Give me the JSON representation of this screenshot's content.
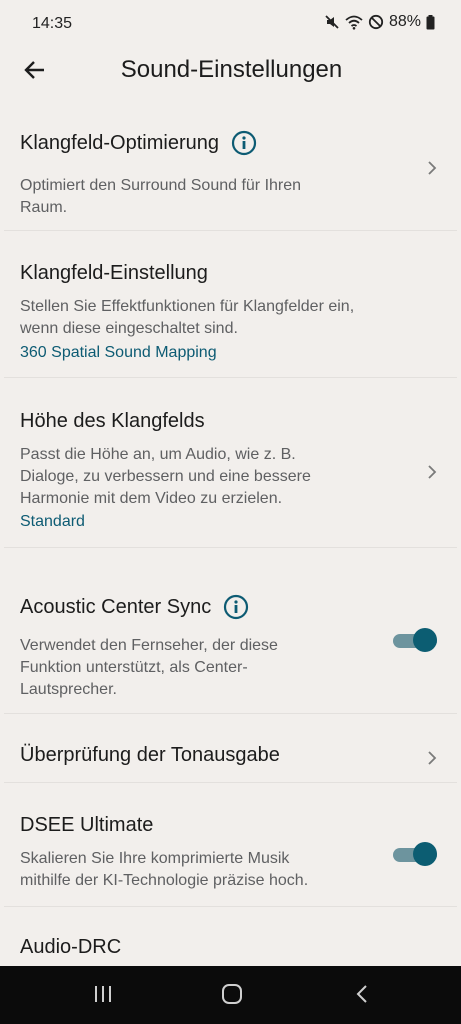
{
  "status_bar": {
    "time": "14:35",
    "battery": "88%",
    "icons": [
      "mute-icon",
      "wifi-icon",
      "do-not-disturb-icon",
      "battery-icon"
    ]
  },
  "header": {
    "title": "Sound-Einstellungen",
    "back_icon": "arrow-left-icon"
  },
  "settings": {
    "klangfeld_optimierung": {
      "title": "Klangfeld-Optimierung",
      "description_line1": "Optimiert den Surround Sound für Ihren",
      "description_line2": "Raum."
    },
    "klangfeld_einstellung": {
      "title": "Klangfeld-Einstellung",
      "description_line1": "Stellen Sie Effektfunktionen für Klangfelder ein,",
      "description_line2": "wenn diese eingeschaltet sind.",
      "value": "360 Spatial Sound Mapping"
    },
    "hoehe_klangfeld": {
      "title": "Höhe des Klangfelds",
      "description_line1": "Passt die Höhe an, um Audio, wie z. B.",
      "description_line2": "Dialoge, zu verbessern und eine bessere",
      "description_line3": "Harmonie mit dem Video zu erzielen.",
      "value": "Standard"
    },
    "acoustic_center_sync": {
      "title": "Acoustic Center Sync",
      "description_line1": "Verwendet den Fernseher, der diese",
      "description_line2": "Funktion unterstützt, als Center-",
      "description_line3": "Lautsprecher.",
      "enabled": true
    },
    "tonausgabe": {
      "title": "Überprüfung der Tonausgabe"
    },
    "dsee_ultimate": {
      "title": "DSEE Ultimate",
      "description_line1": "Skalieren Sie Ihre komprimierte Musik",
      "description_line2": "mithilfe der KI-Technologie präzise hoch.",
      "enabled": true
    },
    "audio_drc": {
      "title": "Audio-DRC"
    }
  },
  "colors": {
    "background": "#f2efec",
    "accent": "#0d5b73",
    "toggle_thumb": "#0c5d72",
    "toggle_track": "#6d949e",
    "description": "#5f6062"
  },
  "nav_bar": {
    "icons": [
      "recent-apps-icon",
      "home-icon",
      "back-icon"
    ]
  }
}
